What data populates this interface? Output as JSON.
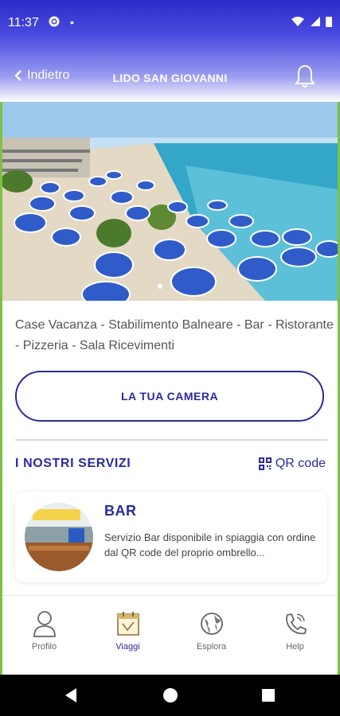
{
  "status_bar": {
    "time": "11:37"
  },
  "header": {
    "back_label": "Indietro",
    "title": "LIDO SAN GIOVANNI"
  },
  "description": "Case Vacanza - Stabilimento Balneare - Bar - Ristorante - Pizzeria - Sala Ricevimenti",
  "camera_button_label": "LA TUA CAMERA",
  "services": {
    "title": "I NOSTRI SERVIZI",
    "qr_label": "QR code",
    "items": [
      {
        "title": "BAR",
        "text": "Servizio Bar disponibile in spiaggia con ordine dal QR code del proprio ombrello..."
      }
    ]
  },
  "tabs": [
    {
      "label": "Profilo",
      "icon": "person-icon",
      "active": false
    },
    {
      "label": "Viaggi",
      "icon": "calendar-icon",
      "active": true
    },
    {
      "label": "Esplora",
      "icon": "globe-icon",
      "active": false
    },
    {
      "label": "Help",
      "icon": "phone-icon",
      "active": false
    }
  ],
  "colors": {
    "accent": "#2a2a9f",
    "header_top": "#2a2cc8",
    "side_border": "#7cc144"
  }
}
